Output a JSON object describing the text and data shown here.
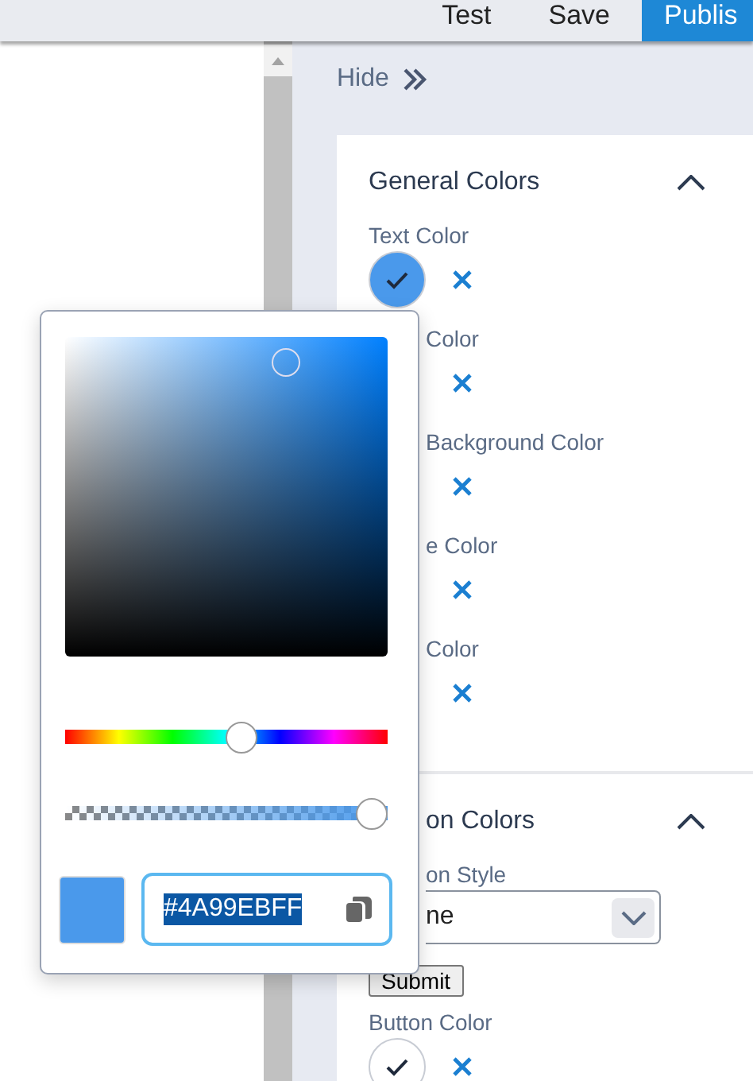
{
  "toolbar": {
    "buttons": [
      {
        "label": "Test",
        "kind": "plain"
      },
      {
        "label": "Save",
        "kind": "plain"
      },
      {
        "label": "Publis",
        "kind": "primary"
      }
    ]
  },
  "panel": {
    "hide_label": "Hide",
    "sections": [
      {
        "title": "General Colors",
        "expanded": true,
        "partly_covered": false,
        "items": [
          {
            "kind": "color",
            "label": "Text Color",
            "partly_covered": false,
            "color": "#4a99eb",
            "selected": true
          },
          {
            "kind": "color",
            "label": "Color",
            "partly_covered": true
          },
          {
            "kind": "color",
            "label": "Background Color",
            "partly_covered": true
          },
          {
            "kind": "color",
            "label": "e Color",
            "partly_covered": true
          },
          {
            "kind": "color",
            "label": "Color",
            "partly_covered": true
          }
        ]
      },
      {
        "title": "on Colors",
        "expanded": true,
        "partly_covered": true,
        "items": [
          {
            "kind": "select",
            "label": "on Style",
            "partly_covered": true,
            "value": "ne"
          },
          {
            "kind": "submit",
            "label": "Submit"
          },
          {
            "kind": "color",
            "label": "Button Color",
            "partly_covered": false,
            "color": "#ffffff",
            "selected": true
          }
        ]
      }
    ]
  },
  "color_picker": {
    "color": "#4a99eb",
    "hue_slider": {
      "level": 0.55
    },
    "alpha_slider": {
      "level": 1
    },
    "hex": "#4A99EBFF"
  }
}
